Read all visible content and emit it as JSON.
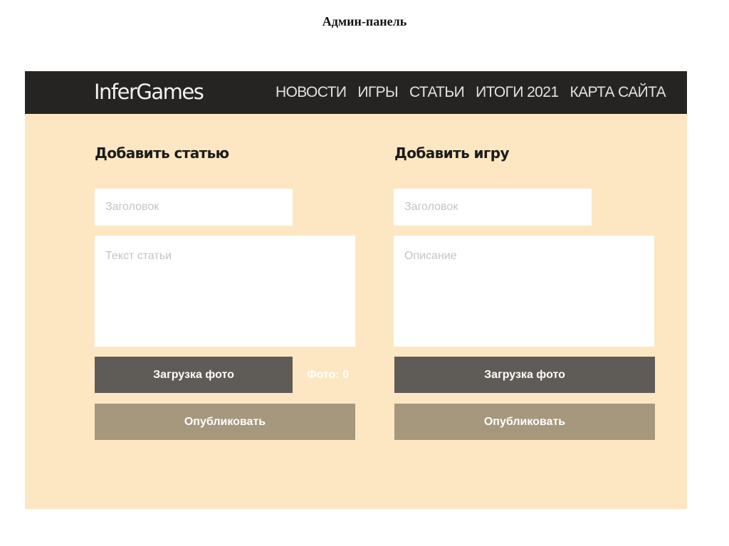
{
  "slide": {
    "title": "Админ-панель"
  },
  "header": {
    "logo": "InferGames",
    "nav": [
      {
        "label": "НОВОСТИ"
      },
      {
        "label": "ИГРЫ"
      },
      {
        "label": "СТАТЬИ"
      },
      {
        "label": "ИТОГИ 2021"
      },
      {
        "label": "КАРТА САЙТА"
      }
    ]
  },
  "article_form": {
    "title": "Добавить статью",
    "title_placeholder": "Заголовок",
    "text_placeholder": "Текст статьи",
    "upload_label": "Загрузка фото",
    "photo_count": "Фото: 0",
    "publish_label": "Опубликовать"
  },
  "game_form": {
    "title": "Добавить игру",
    "title_placeholder": "Заголовок",
    "description_placeholder": "Описание",
    "upload_label": "Загрузка фото",
    "publish_label": "Опубликовать"
  },
  "colors": {
    "header_bg": "#252423",
    "page_bg": "#fde7c2",
    "upload_button": "#5f5c57",
    "publish_button": "#a6987d"
  }
}
